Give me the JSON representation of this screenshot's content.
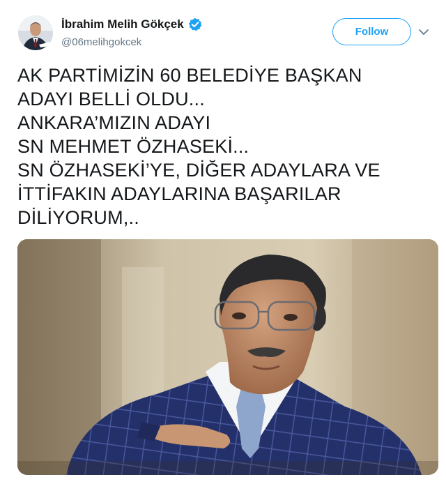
{
  "author": {
    "display_name": "İbrahim Melih Gökçek",
    "handle": "@06melihgokcek",
    "verified": true,
    "avatar_icon": "profile-photo"
  },
  "actions": {
    "follow_label": "Follow",
    "more_icon": "chevron-down-icon"
  },
  "tweet": {
    "lines": [
      "AK PARTİMİZİN 60 BELEDİYE BAŞKAN",
      "ADAYI BELLİ OLDU...",
      "ANKARA’MIZIN ADAYI",
      "SN MEHMET ÖZHASEKİ...",
      "SN ÖZHASEKİ’YE, DİĞER ADAYLARA VE",
      "İTTİFAKIN ADAYLARINA BAŞARILAR",
      "DİLİYORUM,.."
    ]
  },
  "media": {
    "type": "photo"
  },
  "colors": {
    "accent": "#1da1f2",
    "text": "#14171a",
    "secondary": "#657786"
  }
}
